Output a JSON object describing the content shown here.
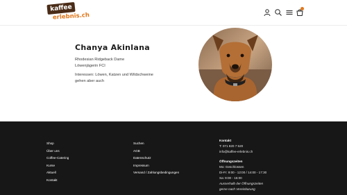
{
  "header": {
    "logo": {
      "line1": "kaffee",
      "line2": "erlebnis.ch"
    },
    "icons": [
      "user-icon",
      "search-icon",
      "menu-icon",
      "cart-icon"
    ]
  },
  "profile": {
    "name": "Chanya Akinlana",
    "details": [
      "Rhodesian Ridgeback Dame",
      "Löwenjägerin FCI"
    ],
    "interests": "Interessen: Löwen, Katzen und Wildschweine gehen aber auch"
  },
  "footer": {
    "col1": [
      "Shop",
      "Über uns",
      "Coffee-Catering",
      "Kurse",
      "Aktuell",
      "Kontakt"
    ],
    "col2": [
      "Suchen",
      "AGB",
      "Datenschutz",
      "Impressum",
      "Versand / Zahlungsbedingungen"
    ],
    "contact": {
      "heading": "Kontakt",
      "phone": "T: 071 820 7 520",
      "email": "info@kaffee-erlebnis.ch"
    },
    "hours": {
      "heading": "Öffnungszeiten",
      "lines": [
        "Mo: Geschlossen",
        "Di-Fr: 9:00 - 12:00 / 14:00 - 17:30",
        "Sa: 9:00 - 15:00"
      ],
      "note1": "Ausserhalb der Öffnungszeiten",
      "note2": "gerne nach Vereinbarung"
    }
  },
  "colors": {
    "brand_brown": "#4a2c17",
    "brand_orange": "#e0781c",
    "footer_bg": "#171717"
  }
}
